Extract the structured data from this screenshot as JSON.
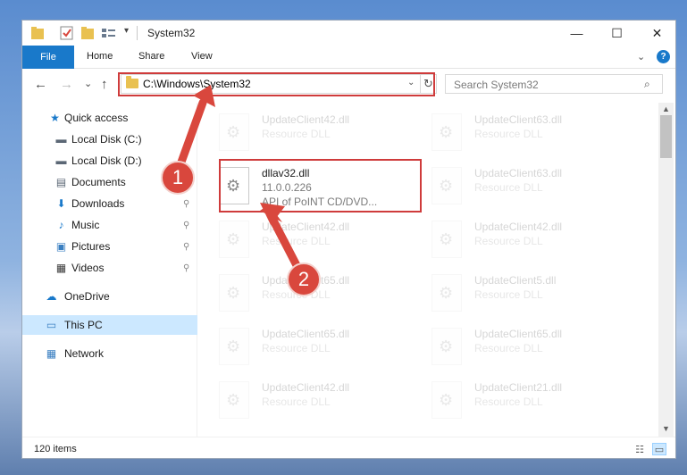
{
  "window": {
    "title": "System32",
    "controls": {
      "minimize": "—",
      "maximize": "☐",
      "close": "✕"
    }
  },
  "ribbon": {
    "file": "File",
    "tabs": [
      "Home",
      "Share",
      "View"
    ],
    "expand_icon": "chevron-down-icon",
    "help_label": "?"
  },
  "nav": {
    "back": "←",
    "forward": "→",
    "recent": "⌄",
    "up": "↑",
    "address": "C:\\Windows\\System32",
    "address_dropdown": "⌄",
    "refresh": "↻",
    "search_placeholder": "Search System32",
    "search_glyph": "⌕"
  },
  "sidebar": {
    "items": [
      {
        "label": "Quick access",
        "icon": "star-icon",
        "glyph": "★",
        "color": "#1979ca",
        "pinned": false
      },
      {
        "label": "Local Disk (C:)",
        "icon": "drive-icon",
        "glyph": "▬",
        "color": "#5b6775",
        "pinned": false
      },
      {
        "label": "Local Disk (D:)",
        "icon": "drive-icon",
        "glyph": "▬",
        "color": "#5b6775",
        "pinned": false
      },
      {
        "label": "Documents",
        "icon": "documents-icon",
        "glyph": "▤",
        "color": "#5b6775",
        "pinned": false
      },
      {
        "label": "Downloads",
        "icon": "downloads-icon",
        "glyph": "⬇",
        "color": "#1979ca",
        "pinned": true
      },
      {
        "label": "Music",
        "icon": "music-icon",
        "glyph": "♪",
        "color": "#1979ca",
        "pinned": true
      },
      {
        "label": "Pictures",
        "icon": "pictures-icon",
        "glyph": "▣",
        "color": "#3a7fc1",
        "pinned": true
      },
      {
        "label": "Videos",
        "icon": "videos-icon",
        "glyph": "▦",
        "color": "#3b3b3b",
        "pinned": true
      },
      {
        "label": "OneDrive",
        "icon": "cloud-icon",
        "glyph": "☁",
        "color": "#1979ca",
        "pinned": false
      },
      {
        "label": "This PC",
        "icon": "computer-icon",
        "glyph": "▭",
        "color": "#3a7fc1",
        "pinned": false,
        "selected": true
      },
      {
        "label": "Network",
        "icon": "network-icon",
        "glyph": "▦",
        "color": "#3a7fc1",
        "pinned": false
      }
    ],
    "pin_glyph": "📌"
  },
  "files": {
    "left_column": [
      {
        "name": "UpdateClient42.dll",
        "desc": "Resource DLL"
      },
      {
        "name": "dllav32.dll",
        "desc": "11.0.0.226",
        "desc2": "API of PoINT CD/DVD...",
        "highlighted": true
      },
      {
        "name": "UpdateClient42.dll",
        "desc": "Resource DLL"
      },
      {
        "name": "UpdateClient65.dll",
        "desc": "Resource DLL"
      },
      {
        "name": "UpdateClient65.dll",
        "desc": "Resource DLL"
      },
      {
        "name": "UpdateClient42.dll",
        "desc": "Resource DLL"
      }
    ],
    "right_column": [
      {
        "name": "UpdateClient63.dll",
        "desc": "Resource DLL"
      },
      {
        "name": "UpdateClient63.dll",
        "desc": "Resource DLL"
      },
      {
        "name": "UpdateClient42.dll",
        "desc": "Resource DLL"
      },
      {
        "name": "UpdateClient5.dll",
        "desc": "Resource DLL"
      },
      {
        "name": "UpdateClient65.dll",
        "desc": "Resource DLL"
      },
      {
        "name": "UpdateClient21.dll",
        "desc": "Resource DLL"
      }
    ]
  },
  "status": {
    "count": "120 items"
  },
  "annotations": {
    "callout_1": "1",
    "callout_2": "2",
    "accent": "#cf3b3b"
  }
}
